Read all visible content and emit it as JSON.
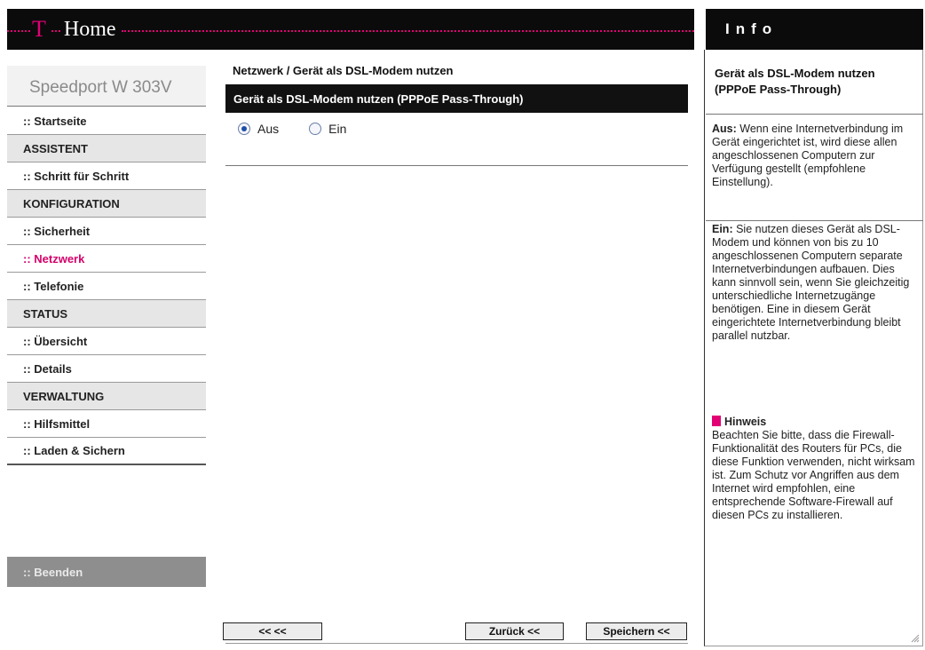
{
  "header": {
    "logo_t": "T",
    "home": "Home",
    "info_title": "Info"
  },
  "sidebar": {
    "product": "Speedport W 303V",
    "items": [
      {
        "type": "link",
        "label": ":: Startseite"
      },
      {
        "type": "section",
        "label": "ASSISTENT"
      },
      {
        "type": "link",
        "label": ":: Schritt für Schritt"
      },
      {
        "type": "section",
        "label": "KONFIGURATION"
      },
      {
        "type": "link",
        "label": ":: Sicherheit"
      },
      {
        "type": "link",
        "label": ":: Netzwerk",
        "active": true
      },
      {
        "type": "link",
        "label": ":: Telefonie"
      },
      {
        "type": "section",
        "label": "STATUS"
      },
      {
        "type": "link",
        "label": ":: Übersicht"
      },
      {
        "type": "link",
        "label": ":: Details"
      },
      {
        "type": "section",
        "label": "VERWALTUNG"
      },
      {
        "type": "link",
        "label": ":: Hilfsmittel"
      },
      {
        "type": "link",
        "label": ":: Laden & Sichern"
      }
    ],
    "logout": ":: Beenden"
  },
  "main": {
    "breadcrumb": "Netzwerk / Gerät als DSL-Modem nutzen",
    "section_title": "Gerät als DSL-Modem nutzen (PPPoE Pass-Through)",
    "radio_options": [
      {
        "label": "Aus",
        "checked": true
      },
      {
        "label": "Ein",
        "checked": false
      }
    ],
    "buttons": {
      "back_back": "<< <<",
      "back": "Zurück <<",
      "save": "Speichern <<"
    }
  },
  "info": {
    "title": "Gerät als DSL-Modem nutzen (PPPoE Pass-Through)",
    "aus_label": "Aus:",
    "aus_text": "Wenn eine Internetverbindung im Gerät eingerichtet ist, wird diese allen angeschlossenen Computern zur Verfügung gestellt (empfohlene Einstellung).",
    "ein_label": "Ein:",
    "ein_text": "Sie nutzen dieses Gerät als DSL-Modem und können von bis zu 10 angeschlossenen Computern separate Internetverbindungen aufbauen. Dies kann sinnvoll sein, wenn Sie gleichzeitig unterschiedliche Internetzugänge benötigen. Eine in diesem Gerät eingerichtete Internetverbindung bleibt parallel nutzbar.",
    "hint_label": "Hinweis",
    "hint_text": "Beachten Sie bitte, dass die Firewall-Funktionalität des Routers für PCs, die diese Funktion verwenden, nicht wirksam ist. Zum Schutz vor Angriffen aus dem Internet wird empfohlen, eine entsprechende Software-Firewall auf diesen PCs zu installieren."
  },
  "colors": {
    "brand_magenta": "#e20074",
    "bar_black": "#0b0b0b"
  }
}
